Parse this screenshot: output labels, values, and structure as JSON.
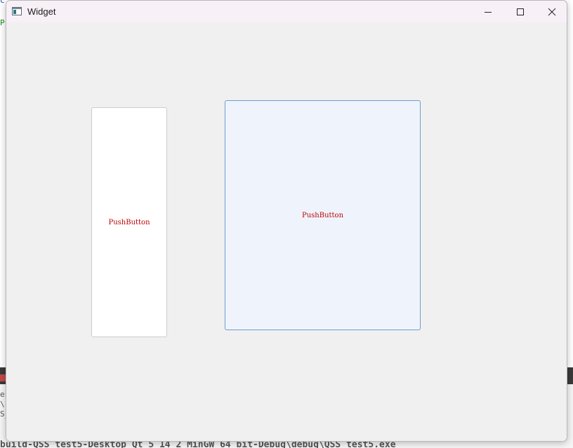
{
  "background": {
    "top_glyph": "c",
    "left_text": "P",
    "lower_lines": [
      "es",
      "\\",
      "S_"
    ],
    "bottom_path": "build-QSS_test5-Desktop_Qt_5_14_2_MinGW_64_bit-Debug\\debug\\QSS_test5.exe"
  },
  "window": {
    "title": "Widget",
    "icon": "app-window-icon",
    "caption_buttons": {
      "minimize_icon": "minimize-icon",
      "maximize_icon": "maximize-icon",
      "close_icon": "close-icon"
    }
  },
  "buttons": [
    {
      "label": "PushButton",
      "state": "normal"
    },
    {
      "label": "PushButton",
      "state": "hover"
    }
  ],
  "colors": {
    "button_text": "#c00000",
    "hover_fill": "#eff4fc",
    "hover_border": "#6f9ccc",
    "window_bg": "#f0f0f0"
  }
}
